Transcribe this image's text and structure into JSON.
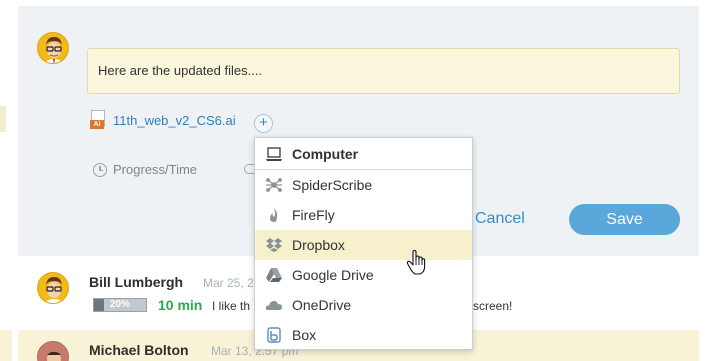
{
  "composer": {
    "message_value": "Here are the updated files....",
    "attachment": {
      "type_label": "Ai",
      "filename": "11th_web_v2_CS6.ai"
    },
    "add_button": "+",
    "progress_time_label": "Progress/Time",
    "cancel_label": "Cancel",
    "save_label": "Save"
  },
  "dropdown": {
    "header": {
      "label": "Computer",
      "icon": "laptop-icon"
    },
    "items": [
      {
        "label": "SpiderScribe",
        "icon": "spiderscribe-icon"
      },
      {
        "label": "FireFly",
        "icon": "firefly-icon"
      },
      {
        "label": "Dropbox",
        "icon": "dropbox-icon",
        "hovered": true
      },
      {
        "label": "Google Drive",
        "icon": "google-drive-icon"
      },
      {
        "label": "OneDrive",
        "icon": "onedrive-icon"
      },
      {
        "label": "Box",
        "icon": "box-icon"
      }
    ]
  },
  "comments": [
    {
      "author": "Bill Lumbergh",
      "date": "Mar 25, 2",
      "progress_percent": "20%",
      "progress_fraction": 0.2,
      "elapsed": "10 min",
      "text_start": "I like th",
      "text_end": "screen!"
    },
    {
      "author": "Michael Bolton",
      "date": "Mar 13, 2:57 pm"
    }
  ],
  "colors": {
    "accent": "#5aa7dc",
    "link": "#3a8cc9",
    "highlight": "#f6f0cc",
    "elapsed_green": "#2fa84f",
    "panel": "#eef2f4"
  }
}
